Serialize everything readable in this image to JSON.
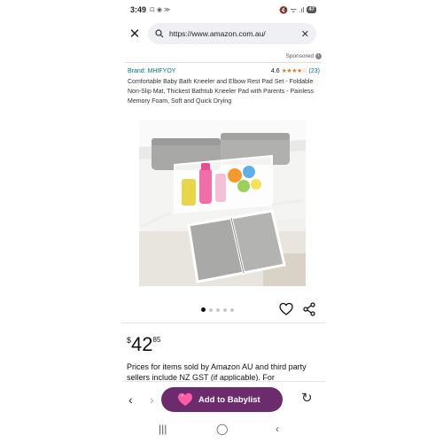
{
  "status": {
    "time": "3:49",
    "left_icons": "⊡ ◉ ≫",
    "right_icons": "🔇 ᯤ .ıl",
    "battery": "47"
  },
  "browser": {
    "url": "https://www.amazon.com.au/",
    "close_icon": "close-icon",
    "clear_icon": "clear-icon"
  },
  "sponsored": {
    "label": "Sponsored"
  },
  "product": {
    "brand": "Brand: MHIFYOY",
    "rating": "4.6",
    "stars": "★★★★☆",
    "review_count": "(23)",
    "title": "Comfortable Baby Bath Kneeler and Elbow Rest Pad Set - Foldable Non-Slip Mat, Thickest Bathtub Kneeler Pad with Parents - Painless Memory Foam, Soft and Quick Drying",
    "image_count": 5,
    "active_image": 1
  },
  "price": {
    "currency": "$",
    "whole": "42",
    "fraction": "85"
  },
  "tax_note": "Prices for items sold by Amazon AU and third party sellers include NZ GST (if applicable). For",
  "bottom_bar": {
    "back_label": "‹",
    "forward_label": "›",
    "babylist_label": "Add to Babylist",
    "reload_label": "↻"
  },
  "android_nav": {
    "recents": "|||",
    "home": "◯",
    "back": "‹"
  },
  "colors": {
    "accent_link": "#007185",
    "star": "#de7921",
    "babylist_button": "#6c2b6d",
    "babylist_heart": "#ff5ca8"
  }
}
